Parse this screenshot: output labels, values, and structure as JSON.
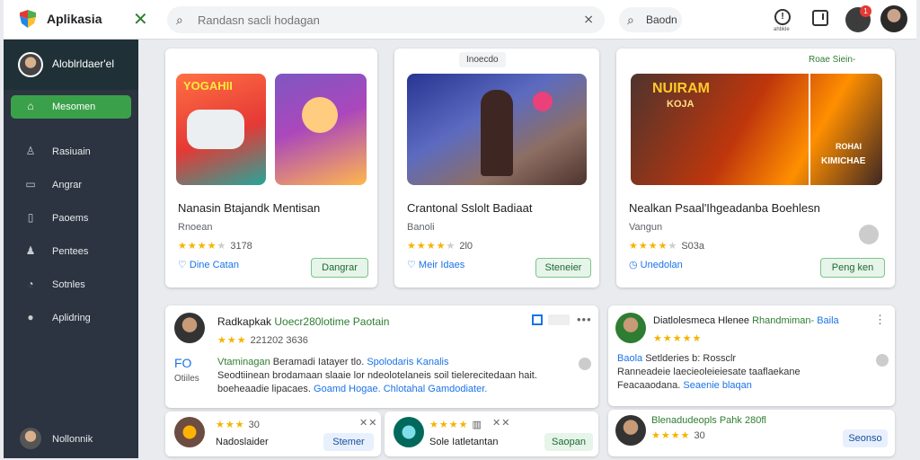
{
  "header": {
    "app_title": "Aplikasia",
    "search_placeholder": "Randasn sacli hodagan",
    "search_button": "Baodn",
    "info_sub": "ahbkle",
    "notification_count": "1"
  },
  "sidebar": {
    "user_name": "Aloblrldaer'el",
    "items": [
      {
        "label": "Mesomen",
        "icon": "home-icon"
      },
      {
        "label": "Rasiuain",
        "icon": "person-icon"
      },
      {
        "label": "Angrar",
        "icon": "monitor-icon"
      },
      {
        "label": "Paoems",
        "icon": "document-icon"
      },
      {
        "label": "Pentees",
        "icon": "group-icon"
      },
      {
        "label": "Sotnles",
        "icon": "tools-icon"
      },
      {
        "label": "Aplidring",
        "icon": "avatar-icon"
      }
    ],
    "footer_label": "Nollonnik"
  },
  "featured": [
    {
      "title": "Nanasin Btajandk Mentisan",
      "subtitle": "Rnoean",
      "rating": "3178",
      "link": "Dine Catan",
      "button": "Dangrar",
      "tag": ""
    },
    {
      "title": "Crantonal Sslolt Badiaat",
      "subtitle": "Banoli",
      "rating": "2l0",
      "link": "Meir Idaes",
      "button": "Steneier",
      "tag": "Inoecdo"
    },
    {
      "title": "Nealkan Psaal'Ihgeadanba Boehlesn",
      "subtitle": "Vangun",
      "rating": "S03a",
      "link": "Unedolan",
      "button": "Peng ken",
      "tag": "Roae Siein-"
    }
  ],
  "thumbnails": {
    "card1_left_banner": "YOGAHII",
    "card3_banner_main": "NUIRAM",
    "card3_banner_sub": "KOJA",
    "card3_side_top": "ROHAI",
    "card3_side_bottom": "KIMICHAE"
  },
  "reviews": [
    {
      "name": "Radkapkak",
      "highlight": "Uoecr280lotime Paotain",
      "stats": "221202 3636",
      "tag_a": "FO",
      "tag_b": "Otiiles",
      "line1": "Vtaminagan",
      "line1b": "Beramadi Iatayer tlo.",
      "line1c": "Spolodaris Kanalis",
      "line2": "Seodtiinean brodamaan slaaie lor ndeolotelaneis soil tielerecitedaan hait.",
      "line3a": "boeheaadie lipacaes.",
      "line3b": "Goamd Hogae.",
      "line3c": "Chlotahal",
      "line3d": "Gamdodiater."
    },
    {
      "name": "Diatlolesmeca Hlenee",
      "highlight": "Rhandmiman-",
      "highlight2": "Baila",
      "line1": "Baola",
      "line1b": "Setlderies b: Rossclr",
      "line2": "Ranneadeie laecieoleieiesate taaflaekane",
      "line3a": "Feacaaodana.",
      "line3b": "Seaenie blaqan"
    }
  ],
  "mini_cards": [
    {
      "name": "Nadoslaider",
      "rating": "30",
      "button": "Stemer"
    },
    {
      "name": "Sole Iatletantan",
      "rating": "",
      "button": "Saopan"
    },
    {
      "name": "Blenadudeopls Pahk 280fl",
      "rating": "30",
      "button": "Seonso"
    }
  ],
  "colors": {
    "accent_green": "#3aa14a",
    "sidebar_bg": "#2b3440",
    "link_blue": "#1a73e8",
    "star": "#f4b400"
  }
}
